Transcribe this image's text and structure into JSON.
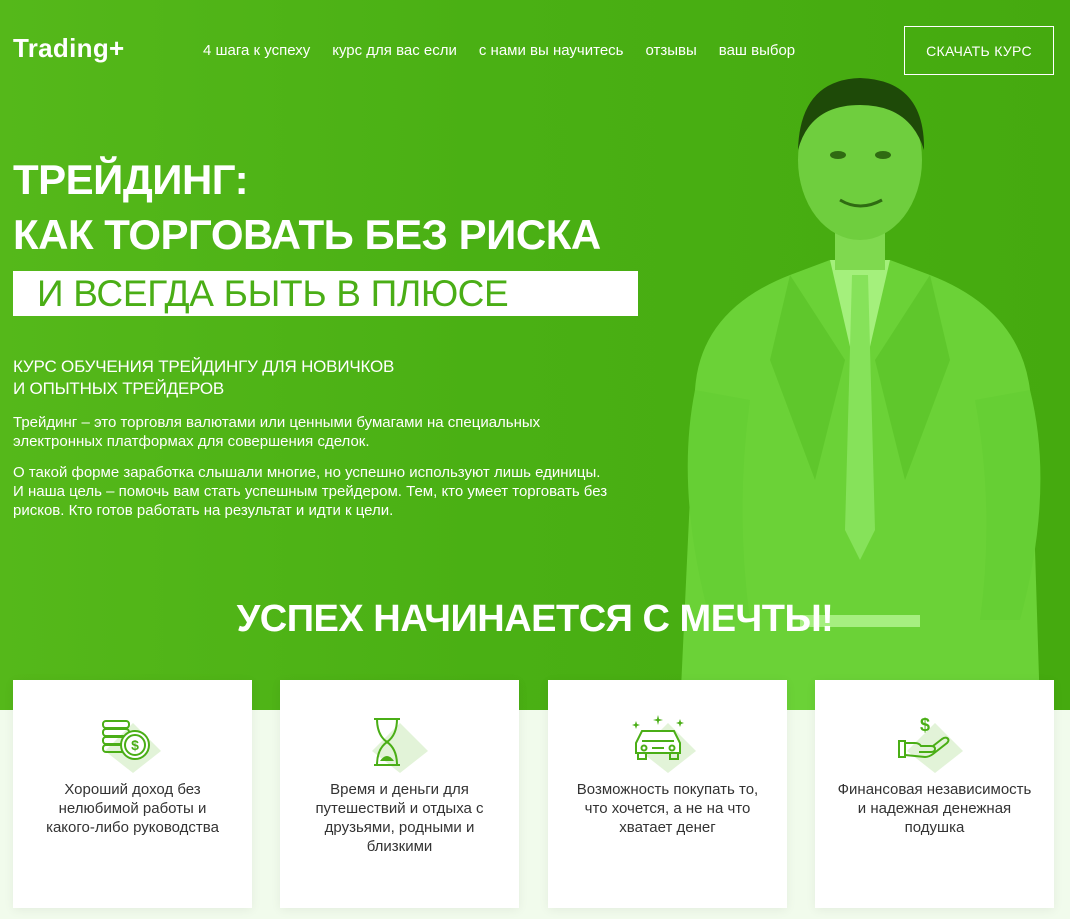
{
  "header": {
    "logo": "Trading+",
    "nav": [
      "4 шага к успеху",
      "курс для вас если",
      "с нами вы научитесь",
      "отзывы",
      "ваш выбор"
    ],
    "cta": "СКАЧАТЬ КУРС"
  },
  "hero": {
    "title_line1": "ТРЕЙДИНГ:",
    "title_line2": "КАК ТОРГОВАТЬ БЕЗ РИСКА",
    "title_line3": "И ВСЕГДА БЫТЬ В ПЛЮСЕ",
    "subtitle_line1": "КУРС ОБУЧЕНИЯ ТРЕЙДИНГУ ДЛЯ НОВИЧКОВ",
    "subtitle_line2": "И ОПЫТНЫХ ТРЕЙДЕРОВ",
    "paragraph1": "Трейдинг – это торговля валютами или ценными бумагами на специальных электронных платформах для совершения сделок.",
    "paragraph2": "О такой форме заработка слышали многие, но успешно используют лишь единицы. И наша цель – помочь вам стать успешным трейдером. Тем, кто умеет торговать без рисков. Кто готов работать на результат и идти к цели."
  },
  "section": {
    "title": "УСПЕХ НАЧИНАЕТСЯ С МЕЧТЫ!"
  },
  "cards": [
    {
      "icon": "coins-icon",
      "text": "Хороший доход без нелюбимой работы и какого-либо руководства"
    },
    {
      "icon": "hourglass-icon",
      "text": "Время и деньги для путешествий и отдыха с друзьями, родными и близкими"
    },
    {
      "icon": "car-icon",
      "text": "Возможность покупать то, что хочется, а не на что хватает денег"
    },
    {
      "icon": "money-hand-icon",
      "text": "Финансовая независимость и надежная денежная подушка"
    }
  ],
  "colors": {
    "brand_green": "#4aae16",
    "card_background": "#ffffff",
    "page_background": "#f1fbec"
  }
}
